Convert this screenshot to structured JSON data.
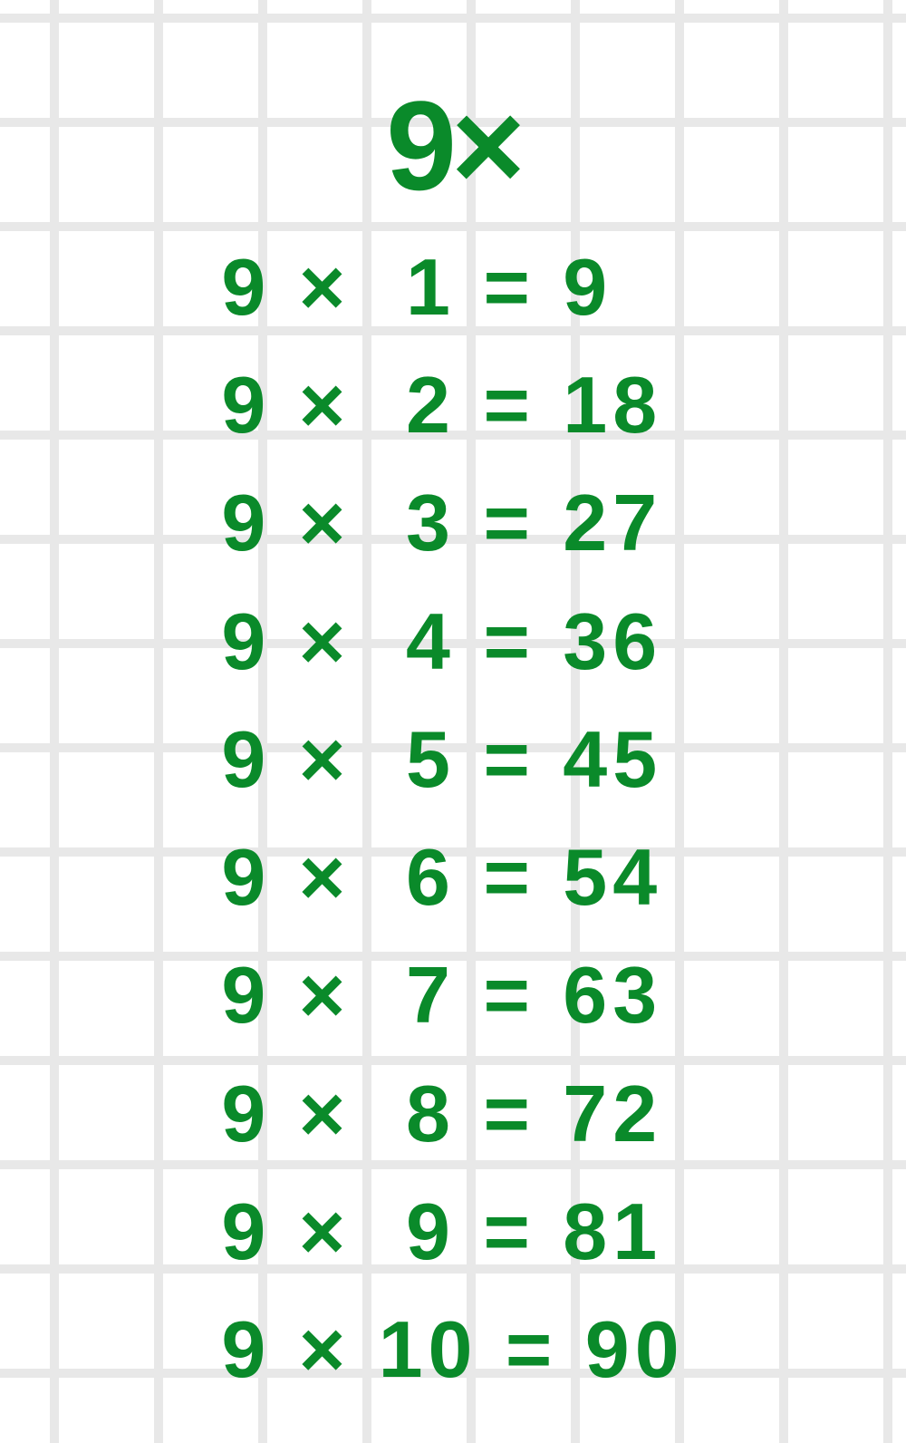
{
  "title": "9×",
  "multiplicand": 9,
  "equations": [
    {
      "a": 9,
      "op": "×",
      "b": 1,
      "eq": "=",
      "r": 9
    },
    {
      "a": 9,
      "op": "×",
      "b": 2,
      "eq": "=",
      "r": 18
    },
    {
      "a": 9,
      "op": "×",
      "b": 3,
      "eq": "=",
      "r": 27
    },
    {
      "a": 9,
      "op": "×",
      "b": 4,
      "eq": "=",
      "r": 36
    },
    {
      "a": 9,
      "op": "×",
      "b": 5,
      "eq": "=",
      "r": 45
    },
    {
      "a": 9,
      "op": "×",
      "b": 6,
      "eq": "=",
      "r": 54
    },
    {
      "a": 9,
      "op": "×",
      "b": 7,
      "eq": "=",
      "r": 63
    },
    {
      "a": 9,
      "op": "×",
      "b": 8,
      "eq": "=",
      "r": 72
    },
    {
      "a": 9,
      "op": "×",
      "b": 9,
      "eq": "=",
      "r": 81
    },
    {
      "a": 9,
      "op": "×",
      "b": 10,
      "eq": "=",
      "r": 90
    }
  ],
  "colors": {
    "ink": "#0a8a2a",
    "grid": "#e8e8e8",
    "paper": "#ffffff"
  }
}
